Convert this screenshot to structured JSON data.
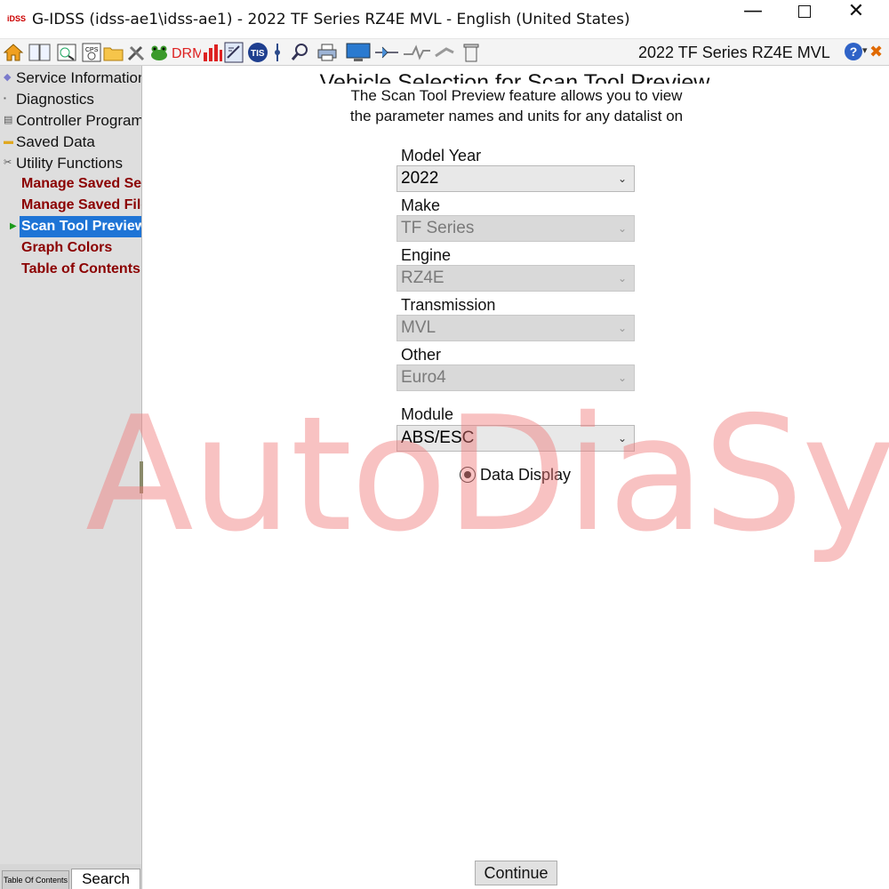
{
  "window": {
    "app_icon_text": "iDSS",
    "title": "G-IDSS (idss-ae1\\idss-ae1) - 2022 TF Series RZ4E MVL - English (United States)",
    "min_glyph": "—",
    "close_glyph": "✕"
  },
  "toolbar": {
    "vehicle_label": "2022 TF Series RZ4E MVL",
    "help_glyph": "?",
    "buttons": [
      "home-icon",
      "book-icon",
      "scan-icon",
      "cps-icon",
      "folder-icon",
      "tools-icon",
      "frog-icon",
      "drm-icon",
      "chart-icon",
      "report-icon",
      "tis-icon",
      "probe-icon",
      "magnifier-icon",
      "printer-icon",
      "monitor-icon",
      "network-icon",
      "signal-icon",
      "delete-icon"
    ],
    "drm_text": "DRM",
    "tis_text": "TIS"
  },
  "sidebar": {
    "items": [
      {
        "label": "Service Information",
        "icon": "◆"
      },
      {
        "label": "Diagnostics",
        "icon": "▪"
      },
      {
        "label": "Controller Programming",
        "icon": "▤"
      },
      {
        "label": "Saved Data",
        "icon": "▬"
      },
      {
        "label": "Utility Functions",
        "icon": "✂"
      }
    ],
    "sub_items": [
      {
        "label": "Manage Saved Sessions"
      },
      {
        "label": "Manage Saved Files"
      },
      {
        "label": "Scan Tool Preview"
      },
      {
        "label": "Graph Colors"
      },
      {
        "label": "Table of Contents"
      }
    ],
    "tabs": {
      "toc": "Table Of Contents",
      "search": "Search"
    }
  },
  "main": {
    "title": "Vehicle Selection for Scan Tool Preview",
    "desc_line1": "The Scan Tool Preview feature allows you to view",
    "desc_line2": "the parameter names and units for any datalist on",
    "fields": [
      {
        "label": "Model Year",
        "value": "2022",
        "enabled": true
      },
      {
        "label": "Make",
        "value": "TF Series",
        "enabled": false
      },
      {
        "label": "Engine",
        "value": "RZ4E",
        "enabled": false
      },
      {
        "label": "Transmission",
        "value": "MVL",
        "enabled": false
      },
      {
        "label": "Other",
        "value": "Euro4",
        "enabled": false
      },
      {
        "label": "Module",
        "value": "ABS/ESC",
        "enabled": true
      }
    ],
    "radio": {
      "label": "Data Display",
      "checked": true
    },
    "continue_label": "Continue"
  },
  "watermark": "AutoDiaSys",
  "colors": {
    "selected_bg": "#1e74d6",
    "sub_item_text": "#8b0000",
    "watermark": "#f07878"
  }
}
